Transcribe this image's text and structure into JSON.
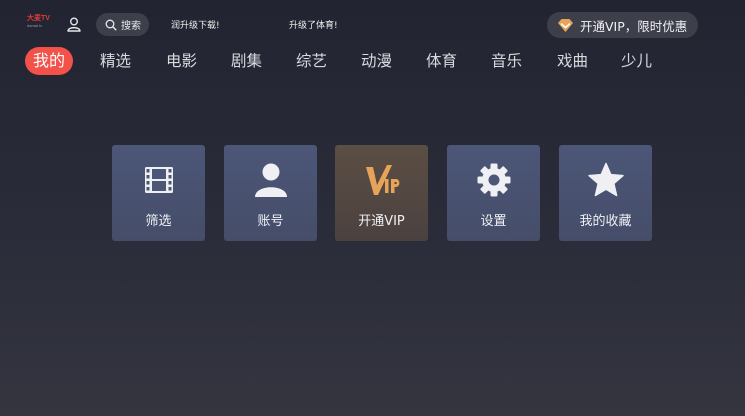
{
  "header": {
    "logo_text": "大麦TV",
    "logo_sub": "damai tv",
    "search_label": "搜索",
    "ticker_left": "润升级下载!",
    "ticker_right": "升级了体育!",
    "vip_label": "开通VIP，限时优惠"
  },
  "nav": {
    "tabs": [
      {
        "label": "我的",
        "active": true
      },
      {
        "label": "精选"
      },
      {
        "label": "电影"
      },
      {
        "label": "剧集"
      },
      {
        "label": "综艺"
      },
      {
        "label": "动漫"
      },
      {
        "label": "体育"
      },
      {
        "label": "音乐"
      },
      {
        "label": "戏曲"
      },
      {
        "label": "少儿"
      }
    ]
  },
  "cards": [
    {
      "label": "筛选",
      "icon": "film-icon"
    },
    {
      "label": "账号",
      "icon": "person-icon"
    },
    {
      "label": "开通VIP",
      "icon": "vip-icon"
    },
    {
      "label": "设置",
      "icon": "gear-icon"
    },
    {
      "label": "我的收藏",
      "icon": "star-icon"
    }
  ],
  "colors": {
    "accent_red": "#f2524a",
    "vip_gold": "#e8a35a",
    "card_blue": "#4c5677"
  }
}
